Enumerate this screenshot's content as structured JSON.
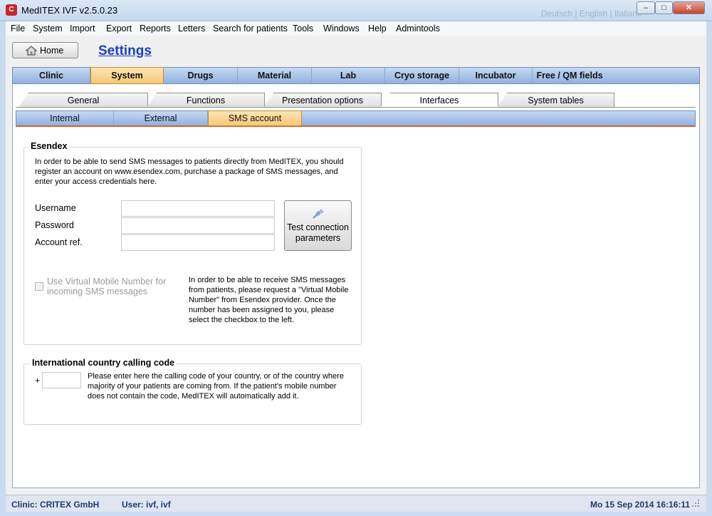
{
  "window": {
    "title": "MedITEX IVF v2.5.0.23",
    "title_right_faded": "Deutsch | English | Italiano",
    "minimize": "–",
    "maximize": "□",
    "close": "✕"
  },
  "menu": [
    "File",
    "System",
    "Import",
    "Export",
    "Reports",
    "Letters",
    "Search for patients",
    "Tools",
    "Windows",
    "Help",
    "Admintools"
  ],
  "header": {
    "home_label": "Home",
    "page_title": "Settings"
  },
  "main_tabs": [
    "Clinic",
    "System",
    "Drugs",
    "Material",
    "Lab",
    "Cryo storage",
    "Incubator",
    "Free / QM fields"
  ],
  "main_tab_active": "System",
  "sub_tabs": [
    "General",
    "Functions",
    "Presentation options",
    "Interfaces",
    "System tables"
  ],
  "sub_tab_active": "Interfaces",
  "tertiary_tabs": [
    "Internal",
    "External",
    "SMS account"
  ],
  "tertiary_tab_active": "SMS account",
  "esendex": {
    "title": "Esendex",
    "intro": "In order to be able to send SMS messages to patients directly from MedITEX, you should register an account on www.esendex.com, purchase a package of SMS messages, and enter your access credentials here.",
    "username_label": "Username",
    "username_value": "",
    "password_label": "Password",
    "password_value": "",
    "account_label": "Account ref.",
    "account_value": "",
    "test_button": "Test connection parameters",
    "vmn_checkbox_label": "Use Virtual Mobile Number for incoming SMS messages",
    "vmn_checked": false,
    "vmn_info": "In order to be able to receive SMS messages from patients, please request a \"Virtual Mobile Number\" from Esendex provider. Once the number has been assigned to you, please select the checkbox to the left."
  },
  "calling_code": {
    "title": "International country calling code",
    "plus": "+",
    "value": "",
    "info": "Please enter here the calling code of your country, or of the country where majority of your patients are coming from. If the patient's mobile number does not contain the code, MedITEX will automatically add it."
  },
  "status": {
    "clinic": "Clinic: CRITEX GmbH",
    "user": "User: ivf, ivf",
    "datetime": "Mo 15 Sep 2014 16:16:11"
  }
}
